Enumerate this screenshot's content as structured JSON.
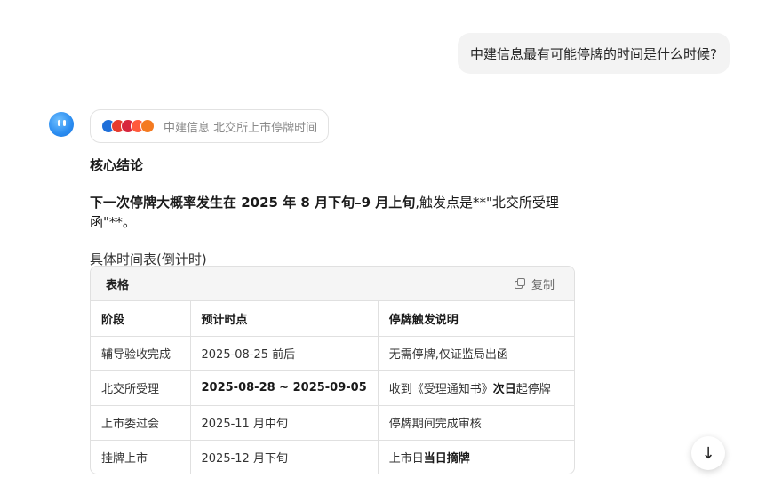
{
  "user_message": "中建信息最有可能停牌的时间是什么时候?",
  "search_chip": {
    "query": "中建信息 北交所上市停牌时间",
    "sources": [
      {
        "icon": "source-icon-1",
        "color": "#1e6fd9"
      },
      {
        "icon": "source-icon-2",
        "color": "#e63b2e"
      },
      {
        "icon": "source-icon-3",
        "color": "#d7263d"
      },
      {
        "icon": "source-icon-4",
        "color": "#ff5a3c"
      },
      {
        "icon": "source-icon-5",
        "color": "#f47a20"
      }
    ]
  },
  "answer": {
    "heading": "核心结论",
    "conclusion_bold": "下一次停牌大概率发生在 2025 年 8 月下旬–9 月上旬",
    "conclusion_rest": ",触发点是**\"北交所受理函\"**。",
    "subhead": "具体时间表(倒计时)"
  },
  "table": {
    "title": "表格",
    "copy_label": "复制",
    "headers": [
      "阶段",
      "预计时点",
      "停牌触发说明"
    ],
    "rows": [
      {
        "stage": "辅导验收完成",
        "time": "2025-08-25 前后",
        "note_pre": "无需停牌,仅证监局出函",
        "note_bold": "",
        "note_post": ""
      },
      {
        "stage": "北交所受理",
        "time": "2025-08-28 ~ 2025-09-05",
        "note_pre": "收到《受理通知书》",
        "note_bold": "次日",
        "note_post": "起停牌"
      },
      {
        "stage": "上市委过会",
        "time": "2025-11 月中旬",
        "note_pre": "停牌期间完成审核",
        "note_bold": "",
        "note_post": ""
      },
      {
        "stage": "挂牌上市",
        "time": "2025-12 月下旬",
        "note_pre": "上市日",
        "note_bold": "当日摘牌",
        "note_post": ""
      }
    ]
  },
  "scroll_button": {
    "icon": "arrow-down-icon",
    "glyph": "↓"
  }
}
